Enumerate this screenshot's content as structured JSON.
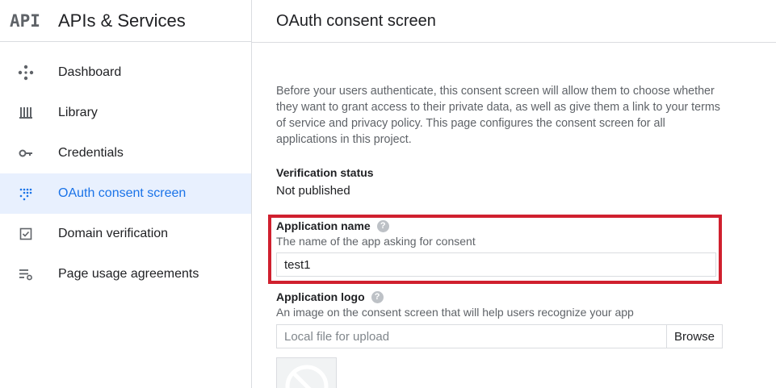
{
  "brand": {
    "logo_text": "API",
    "title": "APIs & Services"
  },
  "sidebar": {
    "items": [
      {
        "label": "Dashboard",
        "icon": "dashboard-icon"
      },
      {
        "label": "Library",
        "icon": "library-icon"
      },
      {
        "label": "Credentials",
        "icon": "key-icon"
      },
      {
        "label": "OAuth consent screen",
        "icon": "oauth-icon",
        "active": true
      },
      {
        "label": "Domain verification",
        "icon": "checkbox-icon"
      },
      {
        "label": "Page usage agreements",
        "icon": "settings-list-icon"
      }
    ]
  },
  "main": {
    "title": "OAuth consent screen",
    "intro": "Before your users authenticate, this consent screen will allow them to choose whether they want to grant access to their private data, as well as give them a link to your terms of service and privacy policy. This page configures the consent screen for all applications in this project.",
    "verification": {
      "label": "Verification status",
      "value": "Not published"
    },
    "app_name": {
      "label": "Application name",
      "help": "?",
      "description": "The name of the app asking for consent",
      "value": "test1"
    },
    "app_logo": {
      "label": "Application logo",
      "help": "?",
      "description": "An image on the consent screen that will help users recognize your app",
      "placeholder": "Local file for upload",
      "browse_label": "Browse"
    }
  },
  "colors": {
    "accent": "#1a73e8",
    "highlight_border": "#d0202e",
    "active_bg": "#e8f0fe"
  }
}
